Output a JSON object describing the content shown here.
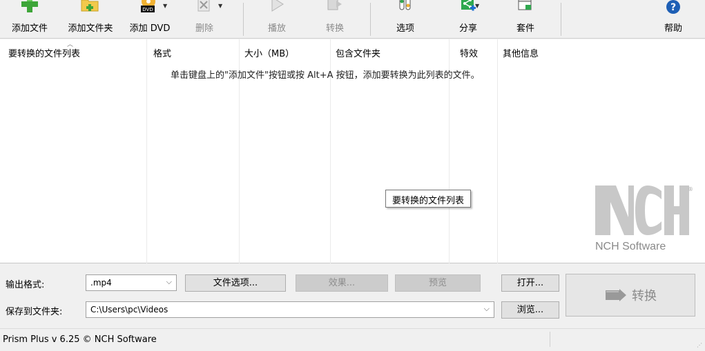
{
  "toolbar": {
    "add_file": "添加文件",
    "add_folder": "添加文件夹",
    "add_dvd": "添加 DVD",
    "delete": "删除",
    "play": "播放",
    "convert": "转换",
    "options": "选项",
    "share": "分享",
    "suite": "套件",
    "help": "帮助",
    "dvd_badge": "DVD"
  },
  "list": {
    "columns": [
      "要转换的文件列表",
      "格式",
      "大小（MB）",
      "包含文件夹",
      "特效",
      "其他信息"
    ],
    "empty_message": "单击键盘上的\"添加文件\"按钮或按 Alt+A 按钮，添加要转换为此列表的文件。",
    "tooltip": "要转换的文件列表"
  },
  "logo": {
    "brand": "NCH Software",
    "registered": "®"
  },
  "controls": {
    "output_format_label": "输出格式:",
    "output_format_value": ".mp4",
    "file_options_button": "文件选项...",
    "effects_button": "效果...",
    "preview_button": "预览",
    "open_button": "打开...",
    "save_to_label": "保存到文件夹:",
    "save_to_value": "C:\\Users\\pc\\Videos",
    "browse_button": "浏览...",
    "convert_button": "转换"
  },
  "status": {
    "text": "Prism Plus v 6.25 © NCH Software"
  },
  "colors": {
    "add_green": "#3ea539",
    "folder_yellow": "#f2c94c",
    "share_green": "#2fa84f",
    "help_blue": "#1e5fb5",
    "logo_gray": "#c8c8c8"
  }
}
